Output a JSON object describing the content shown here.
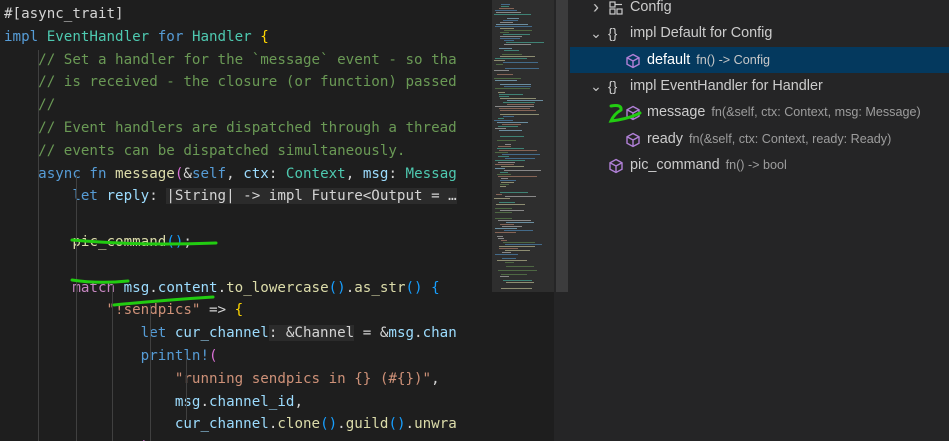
{
  "editor": {
    "lines": [
      [
        {
          "t": "#[async_trait]",
          "c": "punct"
        }
      ],
      [
        {
          "t": "impl ",
          "c": "kw"
        },
        {
          "t": "EventHandler",
          "c": "type"
        },
        {
          "t": " for ",
          "c": "kw"
        },
        {
          "t": "Handler",
          "c": "type"
        },
        {
          "t": " {",
          "c": "brk-y"
        }
      ],
      [
        {
          "t": "    // Set a handler for the `message` event - so tha",
          "c": "cmt"
        }
      ],
      [
        {
          "t": "    // is received - the closure (or function) passed",
          "c": "cmt"
        }
      ],
      [
        {
          "t": "    //",
          "c": "cmt"
        }
      ],
      [
        {
          "t": "    // Event handlers are dispatched through a thread",
          "c": "cmt"
        }
      ],
      [
        {
          "t": "    // events can be dispatched simultaneously.",
          "c": "cmt"
        }
      ],
      [
        {
          "t": "    async fn ",
          "c": "kw"
        },
        {
          "t": "message",
          "c": "fn"
        },
        {
          "t": "(",
          "c": "brk-p"
        },
        {
          "t": "&",
          "c": "punct"
        },
        {
          "t": "self",
          "c": "kw"
        },
        {
          "t": ", ",
          "c": "punct"
        },
        {
          "t": "ctx",
          "c": "var"
        },
        {
          "t": ": ",
          "c": "punct"
        },
        {
          "t": "Context",
          "c": "type"
        },
        {
          "t": ", ",
          "c": "punct"
        },
        {
          "t": "msg",
          "c": "var"
        },
        {
          "t": ": ",
          "c": "punct"
        },
        {
          "t": "Messag",
          "c": "type"
        }
      ],
      [
        {
          "t": "        let ",
          "c": "kw"
        },
        {
          "t": "reply",
          "c": "var"
        },
        {
          "t": ": ",
          "c": "punct"
        },
        {
          "t": "|String| -> impl Future<Output = …",
          "c": "hint"
        }
      ],
      [],
      [
        {
          "t": "        ",
          "c": "punct"
        },
        {
          "t": "pic_command",
          "c": "fn"
        },
        {
          "t": "()",
          "c": "brk-b"
        },
        {
          "t": ";",
          "c": "punct"
        }
      ],
      [],
      [
        {
          "t": "        ",
          "c": "punct"
        },
        {
          "t": "match",
          "c": "ctrl"
        },
        {
          "t": " ",
          "c": "punct"
        },
        {
          "t": "msg",
          "c": "var"
        },
        {
          "t": ".",
          "c": "punct"
        },
        {
          "t": "content",
          "c": "var"
        },
        {
          "t": ".",
          "c": "punct"
        },
        {
          "t": "to_lowercase",
          "c": "fn"
        },
        {
          "t": "()",
          "c": "brk-b"
        },
        {
          "t": ".",
          "c": "punct"
        },
        {
          "t": "as_str",
          "c": "fn"
        },
        {
          "t": "()",
          "c": "brk-b"
        },
        {
          "t": " {",
          "c": "brk-b"
        }
      ],
      [
        {
          "t": "            ",
          "c": "punct"
        },
        {
          "t": "\"!sendpics\"",
          "c": "str"
        },
        {
          "t": " => ",
          "c": "punct"
        },
        {
          "t": "{",
          "c": "brk-y"
        }
      ],
      [
        {
          "t": "                let ",
          "c": "kw"
        },
        {
          "t": "cur_channel",
          "c": "var"
        },
        {
          "t": ": &Channel",
          "c": "hint"
        },
        {
          "t": " = &",
          "c": "punct"
        },
        {
          "t": "msg",
          "c": "var"
        },
        {
          "t": ".",
          "c": "punct"
        },
        {
          "t": "chan",
          "c": "var"
        }
      ],
      [
        {
          "t": "                ",
          "c": "punct"
        },
        {
          "t": "println!",
          "c": "macro"
        },
        {
          "t": "(",
          "c": "brk-p"
        }
      ],
      [
        {
          "t": "                    ",
          "c": "punct"
        },
        {
          "t": "\"running sendpics in {} (#{})\"",
          "c": "str"
        },
        {
          "t": ",",
          "c": "punct"
        }
      ],
      [
        {
          "t": "                    ",
          "c": "punct"
        },
        {
          "t": "msg",
          "c": "var"
        },
        {
          "t": ".",
          "c": "punct"
        },
        {
          "t": "channel_id",
          "c": "var"
        },
        {
          "t": ",",
          "c": "punct"
        }
      ],
      [
        {
          "t": "                    ",
          "c": "punct"
        },
        {
          "t": "cur_channel",
          "c": "var"
        },
        {
          "t": ".",
          "c": "punct"
        },
        {
          "t": "clone",
          "c": "fn"
        },
        {
          "t": "()",
          "c": "brk-b"
        },
        {
          "t": ".",
          "c": "punct"
        },
        {
          "t": "guild",
          "c": "fn"
        },
        {
          "t": "()",
          "c": "brk-b"
        },
        {
          "t": ".",
          "c": "punct"
        },
        {
          "t": "unwra",
          "c": "fn"
        }
      ],
      [
        {
          "t": "                ",
          "c": "punct"
        },
        {
          "t": ");",
          "c": "brk-p"
        }
      ]
    ]
  },
  "outline": {
    "rows": [
      {
        "label": "Config",
        "detail": "",
        "chevron": "›",
        "icon": "struct-icon",
        "indent": 1,
        "selected": false
      },
      {
        "label": "impl Default for Config",
        "detail": "",
        "chevron": "⌄",
        "icon": "namespace-icon",
        "indent": 1,
        "selected": false
      },
      {
        "label": "default",
        "detail": "fn() -> Config",
        "chevron": "",
        "icon": "method-icon",
        "indent": 2,
        "selected": true
      },
      {
        "label": "impl EventHandler for Handler",
        "detail": "",
        "chevron": "⌄",
        "icon": "namespace-icon",
        "indent": 1,
        "selected": false
      },
      {
        "label": "message",
        "detail": "fn(&self, ctx: Context, msg: Message)",
        "chevron": "",
        "icon": "method-icon",
        "indent": 2,
        "selected": false
      },
      {
        "label": "ready",
        "detail": "fn(&self, ctx: Context, ready: Ready)",
        "chevron": "",
        "icon": "method-icon",
        "indent": 2,
        "selected": false
      },
      {
        "label": "pic_command",
        "detail": "fn() -> bool",
        "chevron": "",
        "icon": "method-icon",
        "indent": 1,
        "selected": false
      }
    ]
  },
  "colors": {
    "annotation": "#22cc11",
    "method": "#b180d7",
    "selection": "#04395e"
  }
}
